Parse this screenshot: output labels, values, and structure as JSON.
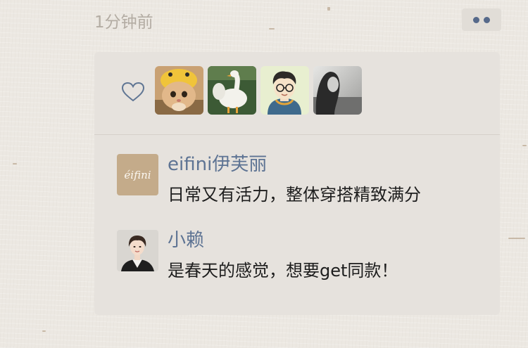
{
  "moment": {
    "timestamp": "1分钟前",
    "more_icon": "more-dots-icon"
  },
  "likes": {
    "icon": "heart-outline-icon",
    "avatars": [
      {
        "name": "avatar-cat-in-duck-hat"
      },
      {
        "name": "avatar-white-geese"
      },
      {
        "name": "avatar-cartoon-boy-glasses"
      },
      {
        "name": "avatar-girl-monochrome"
      }
    ]
  },
  "comments": [
    {
      "author": "eifini伊芙丽",
      "text": "日常又有活力，整体穿搭精致满分",
      "avatar_logo": "éifini"
    },
    {
      "author": "小赖",
      "text": "是春天的感觉，想要get同款！"
    }
  ],
  "colors": {
    "background": "#ece8e2",
    "card": "#e6e2dd",
    "name_link": "#5d7393",
    "timestamp": "#b3aca3",
    "dots": "#56698a"
  }
}
